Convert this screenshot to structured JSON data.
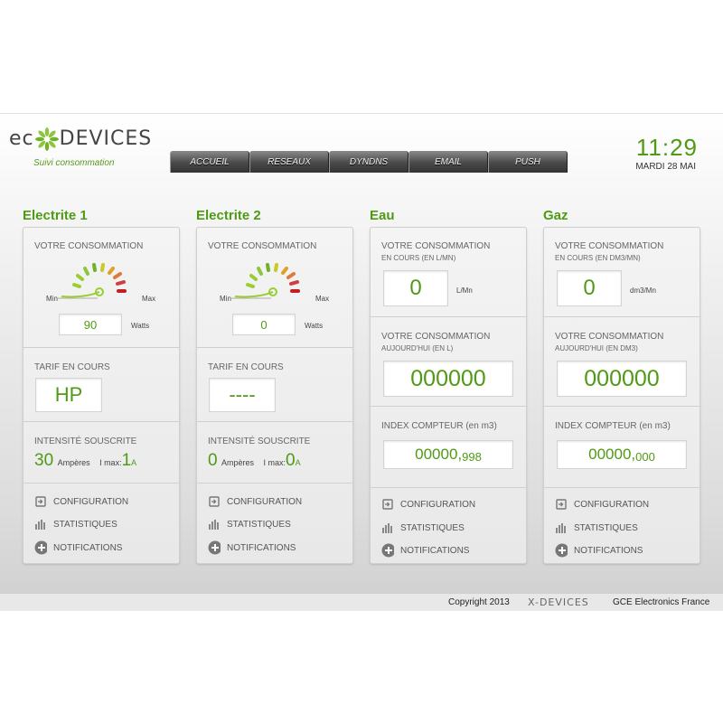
{
  "header": {
    "logo_left": "ec",
    "logo_right": "DEVICES",
    "subtitle": "Suivi consommation",
    "time": "11:29",
    "date": "MARDI 28 MAI"
  },
  "nav": {
    "tabs": [
      {
        "label": "ACCUEIL"
      },
      {
        "label": "RESEAUX"
      },
      {
        "label": "DYNDNS"
      },
      {
        "label": "EMAIL"
      },
      {
        "label": "PUSH"
      }
    ]
  },
  "electrite1": {
    "title": "Electrite 1",
    "conso_label": "VOTRE CONSOMMATION",
    "gauge_min": "Min",
    "gauge_max": "Max",
    "value": "90",
    "unit": "Watts",
    "tarif_label": "TARIF EN COURS",
    "tarif": "HP",
    "intensity_label": "INTENSITÉ SOUSCRITE",
    "intensity_value": "30",
    "intensity_unit": "Ampères",
    "imax_label": "I max:",
    "imax_value": "1",
    "imax_unit": "A"
  },
  "electrite2": {
    "title": "Electrite 2",
    "conso_label": "VOTRE CONSOMMATION",
    "gauge_min": "Min",
    "gauge_max": "Max",
    "value": "0",
    "unit": "Watts",
    "tarif_label": "TARIF EN COURS",
    "tarif": "----",
    "intensity_label": "INTENSITÉ SOUSCRITE",
    "intensity_value": "0",
    "intensity_unit": "Ampères",
    "imax_label": "I max:",
    "imax_value": "0",
    "imax_unit": "A"
  },
  "eau": {
    "title": "Eau",
    "conso_label": "VOTRE CONSOMMATION",
    "conso_sublabel": "EN COURS (EN L/MN)",
    "current": "0",
    "current_unit": "L/Mn",
    "today_label": "VOTRE CONSOMMATION",
    "today_sublabel": "AUJOURD'HUI (EN L)",
    "today": "000000",
    "index_label": "INDEX COMPTEUR (en m3)",
    "index_int": "00000,",
    "index_dec": "998"
  },
  "gaz": {
    "title": "Gaz",
    "conso_label": "VOTRE CONSOMMATION",
    "conso_sublabel": "EN COURS (EN DM3/MN)",
    "current": "0",
    "current_unit": "dm3/Mn",
    "today_label": "VOTRE CONSOMMATION",
    "today_sublabel": "AUJOURD'HUI (EN DM3)",
    "today": "000000",
    "index_label": "INDEX COMPTEUR (en m3)",
    "index_int": "00000,",
    "index_dec": "000"
  },
  "links": {
    "configuration": "CONFIGURATION",
    "statistiques": "STATISTIQUES",
    "notifications": "NOTIFICATIONS"
  },
  "footer": {
    "copyright": "Copyright 2013",
    "brand": "X-DEVICES",
    "company": "GCE Electronics France"
  },
  "colors": {
    "accent_green": "#4f9a15"
  }
}
